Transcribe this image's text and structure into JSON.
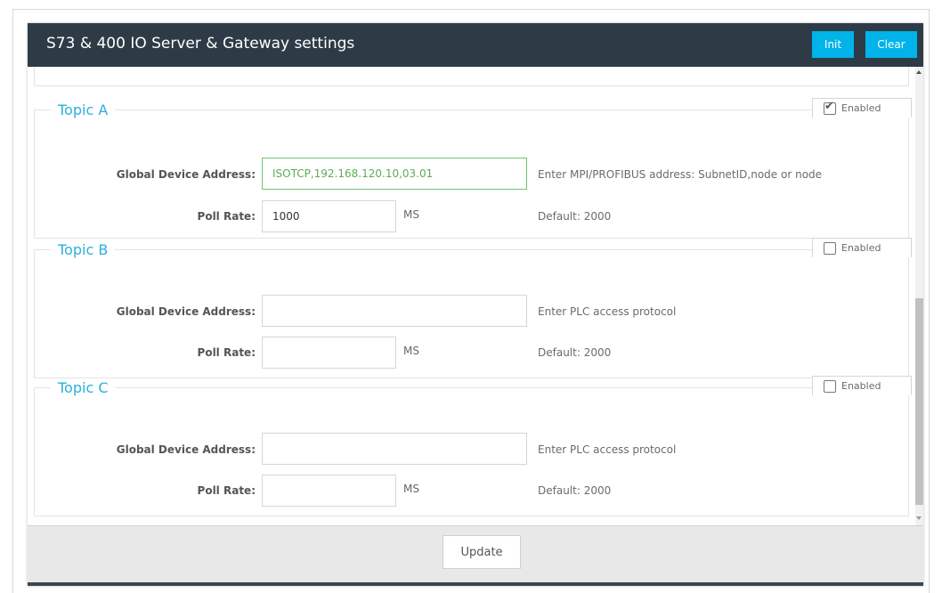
{
  "header": {
    "title": "S73 & 400 IO Server & Gateway settings",
    "init_label": "Init",
    "clear_label": "Clear"
  },
  "topics": [
    {
      "title": "Topic A",
      "enabled_label": "Enabled",
      "enabled": true,
      "address_label": "Global Device Address:",
      "address_value": "ISOTCP,192.168.120.10,03.01",
      "address_hint": "Enter MPI/PROFIBUS address: SubnetID,node or node",
      "poll_label": "Poll Rate:",
      "poll_value": "1000",
      "poll_unit": "MS",
      "poll_hint": "Default: 2000"
    },
    {
      "title": "Topic B",
      "enabled_label": "Enabled",
      "enabled": false,
      "address_label": "Global Device Address:",
      "address_value": "",
      "address_hint": "Enter PLC access protocol",
      "poll_label": "Poll Rate:",
      "poll_value": "",
      "poll_unit": "MS",
      "poll_hint": "Default: 2000"
    },
    {
      "title": "Topic C",
      "enabled_label": "Enabled",
      "enabled": false,
      "address_label": "Global Device Address:",
      "address_value": "",
      "address_hint": "Enter PLC access protocol",
      "poll_label": "Poll Rate:",
      "poll_value": "",
      "poll_unit": "MS",
      "poll_hint": "Default: 2000"
    }
  ],
  "footer": {
    "update_label": "Update"
  },
  "colors": {
    "header_bg": "#2e3b47",
    "accent": "#00b3e8",
    "topic_title": "#2ab0dd",
    "valid_border": "#6cc56c"
  }
}
